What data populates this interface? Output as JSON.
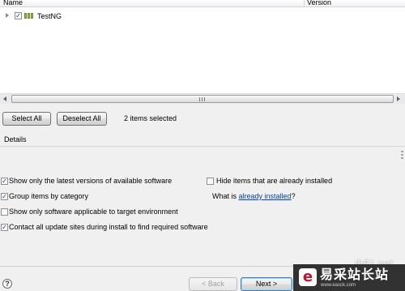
{
  "tree": {
    "columns": {
      "name": "Name",
      "version": "Version"
    },
    "rows": [
      {
        "label": "TestNG",
        "checked": true,
        "expanded": false
      }
    ]
  },
  "selection": {
    "select_all_label": "Select All",
    "deselect_all_label": "Deselect All",
    "count_text": "2 items selected"
  },
  "details": {
    "label": "Details"
  },
  "options": {
    "latest_versions": {
      "label": "Show only the latest versions of available software",
      "checked": true
    },
    "hide_installed": {
      "label": "Hide items that are already installed",
      "checked": false
    },
    "group_by_category": {
      "label": "Group items by category",
      "checked": true
    },
    "what_is_prefix": "What is ",
    "already_installed_link": "already installed",
    "what_is_suffix": "?",
    "target_env": {
      "label": "Show only software applicable to target environment",
      "checked": false
    },
    "contact_sites": {
      "label": "Contact all update sites during install to find required software",
      "checked": true
    }
  },
  "footer": {
    "help_glyph": "?",
    "back_label": "< Back",
    "next_label": "Next >"
  },
  "watermark": {
    "url_text": "jb51.net",
    "logo_glyph": "e",
    "site_name": "易采站长站",
    "site_url": "www.easck.com"
  },
  "icons": {
    "expander": "chevron-right-icon",
    "package": "feature-group-icon",
    "help": "help-icon",
    "checkmark": "checkmark-icon"
  }
}
